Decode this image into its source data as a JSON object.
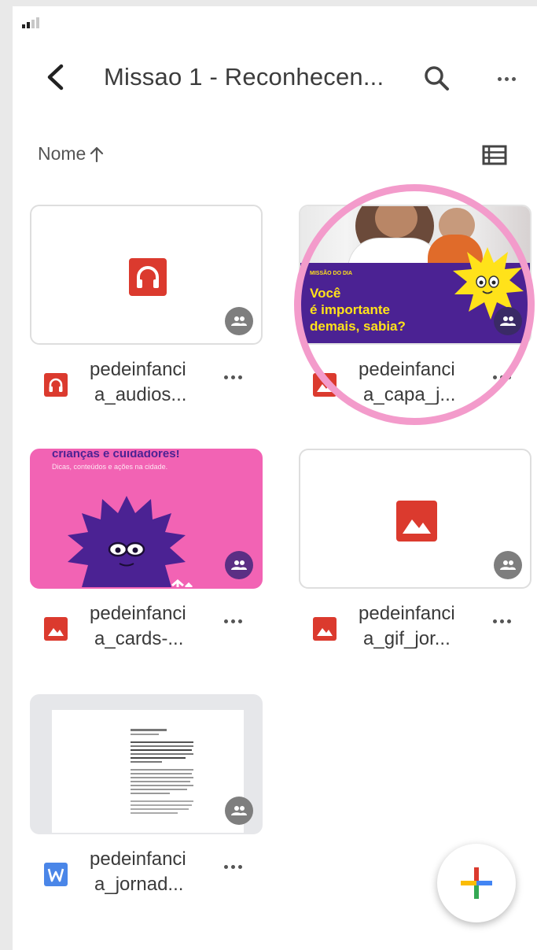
{
  "topbar": {
    "title": "Missao 1 - Reconhecen...",
    "back_icon": "chevron-left-icon",
    "search_icon": "search-icon",
    "more_icon": "more-horizontal-icon"
  },
  "sort": {
    "label": "Nome",
    "direction_icon": "arrow-up-icon",
    "view_toggle_icon": "list-view-icon"
  },
  "files": [
    {
      "name_line1": "pedeinfanci",
      "name_line2": "a_audios...",
      "type_icon": "headphones-icon",
      "shared_icon": "shared-people-icon"
    },
    {
      "name_line1": "pedeinfanci",
      "name_line2": "a_capa_j...",
      "type_icon": "image-icon",
      "shared_icon": "shared-people-icon",
      "thumb": {
        "kicker": "MISSÃO DO DIA",
        "line1": "Você",
        "line2": "é importante",
        "line3": "demais, sabia?"
      }
    },
    {
      "name_line1": "pedeinfanci",
      "name_line2": "a_cards-...",
      "type_icon": "image-icon",
      "shared_icon": "shared-people-icon",
      "thumb": {
        "heading": "crianças e cuidadores!",
        "sub": "Dicas, conteúdos e ações na cidade."
      }
    },
    {
      "name_line1": "pedeinfanci",
      "name_line2": "a_gif_jor...",
      "type_icon": "image-icon",
      "shared_icon": "shared-people-icon"
    },
    {
      "name_line1": "pedeinfanci",
      "name_line2": "a_jornad...",
      "type_icon": "word-doc-icon",
      "shared_icon": "shared-people-icon"
    }
  ],
  "fab": {
    "icon": "plus-multicolor-icon"
  },
  "colors": {
    "red": "#db3a2e",
    "purple": "#4b2293",
    "pink": "#f263b4",
    "yellow": "#ffe21a",
    "ring": "#f39bcb",
    "word_blue": "#4a86e8"
  }
}
